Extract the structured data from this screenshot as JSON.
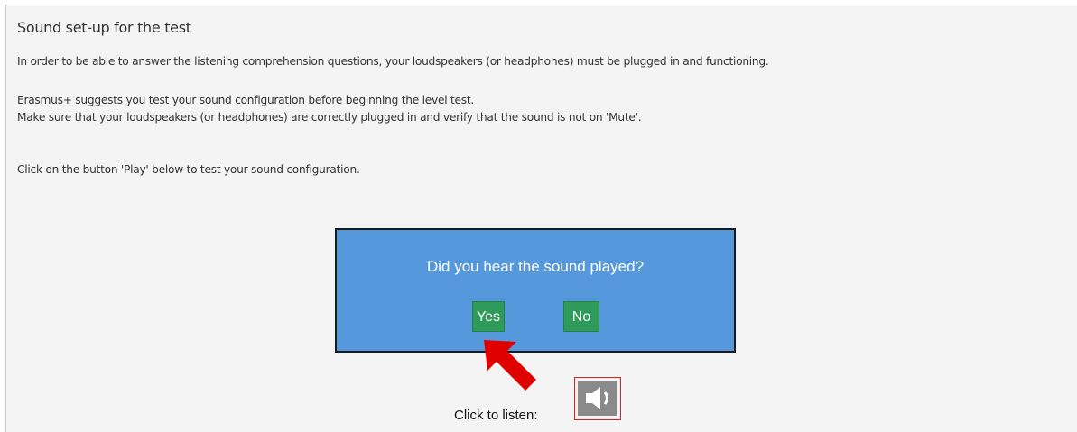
{
  "page": {
    "title": "Sound set-up for the test",
    "paragraphs": [
      "In order to be able to answer the listening comprehension questions, your loudspeakers (or headphones) must be plugged in and functioning.",
      "Erasmus+ suggests you test your sound configuration before beginning the level test.",
      "Make sure that your loudspeakers (or headphones) are correctly plugged in and verify that the sound is not on 'Mute'.",
      "Click on the button 'Play' below to test your sound configuration."
    ]
  },
  "dialog": {
    "question": "Did you hear the sound played?",
    "yes_label": "Yes",
    "no_label": "No"
  },
  "player": {
    "label": "Click to listen:",
    "icon": "speaker-icon"
  },
  "annotation": {
    "arrow_icon": "red-arrow-icon",
    "color": "#e00000"
  }
}
